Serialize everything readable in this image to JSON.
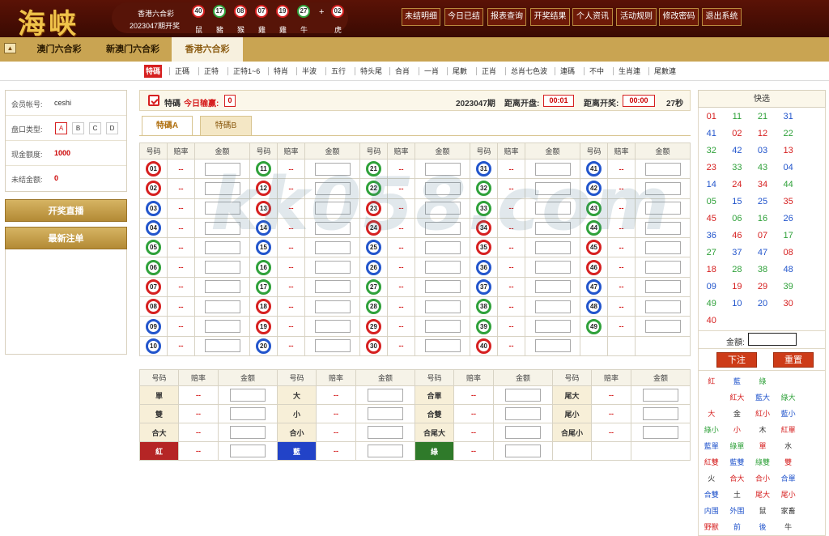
{
  "header": {
    "logo": "海峡",
    "draw_lottery": "香港六合彩",
    "draw_issue": "2023047期开奖",
    "balls": [
      {
        "num": "40",
        "zodiac": "鼠",
        "color": "red"
      },
      {
        "num": "17",
        "zodiac": "豬",
        "color": "green"
      },
      {
        "num": "08",
        "zodiac": "猴",
        "color": "red"
      },
      {
        "num": "07",
        "zodiac": "雞",
        "color": "red"
      },
      {
        "num": "19",
        "zodiac": "雞",
        "color": "red"
      },
      {
        "num": "27",
        "zodiac": "牛",
        "color": "green"
      }
    ],
    "plus": "+",
    "special": {
      "num": "02",
      "zodiac": "虎",
      "color": "red"
    },
    "nav": [
      "未结明细",
      "今日已结",
      "报表查询",
      "开奖结果",
      "个人资讯",
      "活动规则",
      "修改密码",
      "退出系统"
    ]
  },
  "lottery_tabs": [
    "澳门六合彩",
    "新澳门六合彩",
    "香港六合彩"
  ],
  "active_lottery": 2,
  "sub_tabs": [
    "特碼",
    "正碼",
    "正特",
    "正特1~6",
    "特肖",
    "半波",
    "五行",
    "特头尾",
    "合肖",
    "一肖",
    "尾數",
    "正肖",
    "总肖七色波",
    "連碼",
    "不中",
    "生肖連",
    "尾數連"
  ],
  "sidebar": {
    "account_label": "会员帐号:",
    "account_value": "ceshi",
    "type_label": "盘口类型:",
    "types": [
      "A",
      "B",
      "C",
      "D"
    ],
    "credit_label": "现金额度:",
    "credit_value": "1000",
    "unsettled_label": "未结金额:",
    "unsettled_value": "0",
    "live_button": "开奖直播",
    "latest_button": "最新注单"
  },
  "infobar": {
    "label": "特碼",
    "win_label": "今日输赢:",
    "win_value": "0",
    "issue": "2023047期",
    "close_label": "距离开盘:",
    "close_value": "00:01",
    "open_label": "距离开奖:",
    "open_value": "00:00",
    "seconds": "27秒"
  },
  "bet_tabs": [
    "特碼A",
    "特碼B"
  ],
  "grid": {
    "col_headers": [
      "号码",
      "赔率",
      "金额"
    ],
    "odds": "--",
    "numbers": [
      [
        "01",
        "11",
        "21",
        "31",
        "41"
      ],
      [
        "02",
        "12",
        "22",
        "32",
        "42"
      ],
      [
        "03",
        "13",
        "23",
        "33",
        "43"
      ],
      [
        "04",
        "14",
        "24",
        "34",
        "44"
      ],
      [
        "05",
        "15",
        "25",
        "35",
        "45"
      ],
      [
        "06",
        "16",
        "26",
        "36",
        "46"
      ],
      [
        "07",
        "17",
        "27",
        "37",
        "47"
      ],
      [
        "08",
        "18",
        "28",
        "38",
        "48"
      ],
      [
        "09",
        "19",
        "29",
        "39",
        "49"
      ],
      [
        "10",
        "20",
        "30",
        "40",
        ""
      ]
    ]
  },
  "prop": {
    "rows": [
      [
        "單",
        "大",
        "合單",
        "尾大"
      ],
      [
        "雙",
        "小",
        "合雙",
        "尾小"
      ],
      [
        "合大",
        "合小",
        "合尾大",
        "合尾小"
      ],
      [
        "紅",
        "藍",
        "綠",
        ""
      ]
    ]
  },
  "quick": {
    "title": "快选",
    "numbers": [
      "01",
      "11",
      "21",
      "31",
      "41",
      "02",
      "12",
      "22",
      "32",
      "42",
      "03",
      "13",
      "23",
      "33",
      "43",
      "04",
      "14",
      "24",
      "34",
      "44",
      "05",
      "15",
      "25",
      "35",
      "45",
      "06",
      "16",
      "26",
      "36",
      "46",
      "07",
      "17",
      "27",
      "37",
      "47",
      "08",
      "18",
      "28",
      "38",
      "48",
      "09",
      "19",
      "29",
      "39",
      "49",
      "10",
      "20",
      "30",
      "40",
      ""
    ],
    "amount_label": "金額:",
    "submit": "下注",
    "reset": "重置",
    "cats": [
      "紅",
      "藍",
      "綠",
      "",
      "",
      " 紅大",
      "藍大",
      "綠大",
      "大",
      "金",
      "紅小",
      "藍小",
      "綠小",
      "小",
      "木",
      "紅單",
      "藍單",
      "綠單",
      "單",
      "水",
      "紅雙",
      "藍雙",
      "綠雙",
      "雙",
      "火",
      "合大",
      "合小",
      "合單",
      "合雙",
      "土",
      "尾大",
      "尾小",
      "内围",
      "外围",
      "鼠",
      "家畜",
      "野獸",
      "前",
      "後",
      "牛"
    ]
  },
  "watermark": "kk058.com",
  "watermark2": "海峡",
  "colors": {
    "red": "#d62020",
    "blue": "#2255cc",
    "green": "#2fa13a",
    "gold": "#c9a452"
  }
}
